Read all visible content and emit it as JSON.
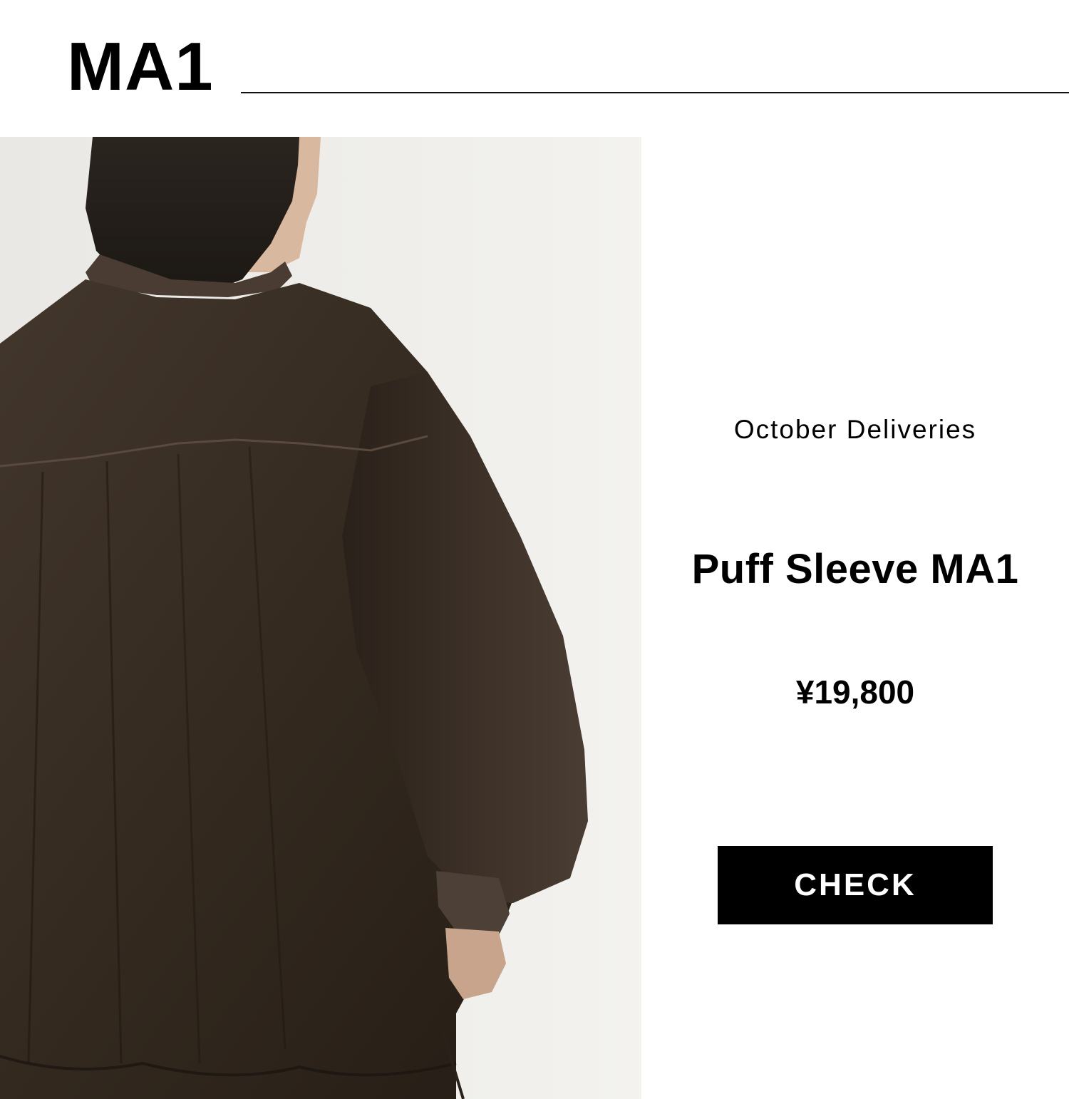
{
  "header": {
    "title": "MA1"
  },
  "product": {
    "delivery_label": "October Deliveries",
    "name": "Puff Sleeve MA1",
    "price": "¥19,800",
    "cta_label": "CHECK"
  },
  "colors": {
    "background": "#ffffff",
    "text": "#000000",
    "button_background": "#000000",
    "button_text": "#ffffff",
    "jacket": "#3a2f27"
  }
}
